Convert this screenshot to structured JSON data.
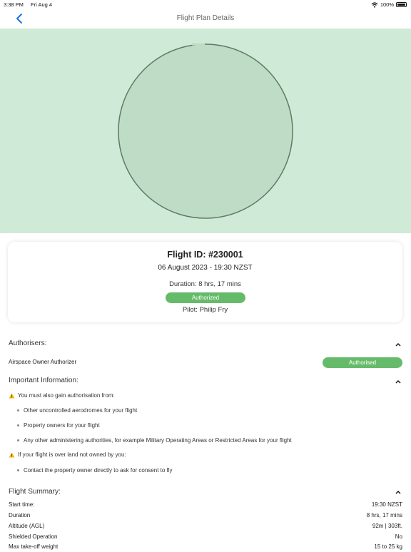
{
  "status_bar": {
    "time": "3:38 PM",
    "date": "Fri Aug 4",
    "battery": "100%"
  },
  "nav": {
    "title": "Flight Plan Details",
    "back_icon": "chevron-left-icon"
  },
  "summary_card": {
    "flight_id": "Flight ID: #230001",
    "datetime": "06 August 2023 - 19:30 NZST",
    "duration": "Duration: 8 hrs, 17 mins",
    "status": "Authorized",
    "pilot": "Pilot: Philip Fry"
  },
  "authorisers": {
    "heading": "Authorisers:",
    "items": [
      {
        "name": "Airspace Owner Authorizer",
        "status": "Authorised"
      }
    ]
  },
  "important_info": {
    "heading": "Important Information:",
    "warning_1": "You must also gain authorisation from:",
    "bullets_1": [
      "Other uncontrolled aerodromes for your flight",
      "Property owners for your flight",
      "Any other administering authorities, for example Military Operating Areas or Restricted Areas for your flight"
    ],
    "warning_2": "If your flight is over land not owned by you:",
    "bullets_2": [
      "Contact the property owner directly to ask for consent to fly"
    ]
  },
  "flight_summary": {
    "heading": "Flight Summary:",
    "rows": [
      {
        "label": "Start time:",
        "value": "19:30 NZST"
      },
      {
        "label": "Duration",
        "value": "8 hrs, 17 mins"
      },
      {
        "label": "Altitude (AGL)",
        "value": "92m | 303ft."
      },
      {
        "label": "Shielded Operation",
        "value": "No"
      },
      {
        "label": "Max take-off weight",
        "value": "15 to 25 kg"
      }
    ]
  },
  "colors": {
    "map_bg": "#cfead6",
    "area_fill": "#bfdcc6",
    "area_stroke": "#5f7a63",
    "status_green": "#66bb6a"
  }
}
